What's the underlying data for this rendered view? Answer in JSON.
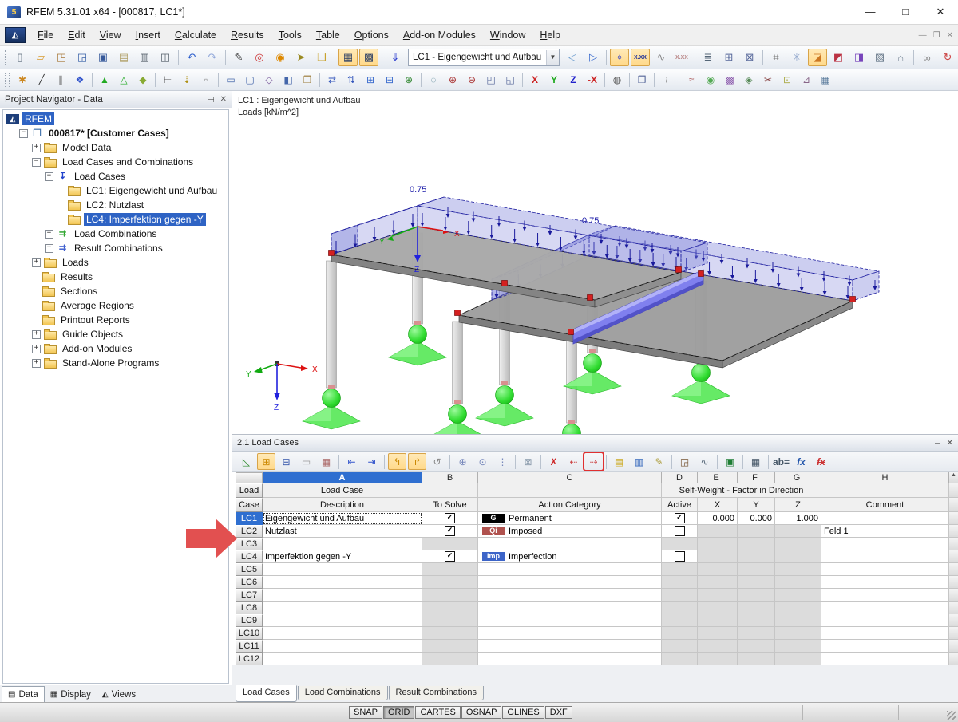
{
  "window": {
    "title": "RFEM 5.31.01 x64 - [000817, LC1*]",
    "controls": {
      "minimize": "—",
      "maximize": "□",
      "close": "✕"
    }
  },
  "menubar": {
    "items": [
      "File",
      "Edit",
      "View",
      "Insert",
      "Calculate",
      "Results",
      "Tools",
      "Table",
      "Options",
      "Add-on Modules",
      "Window",
      "Help"
    ]
  },
  "toolbar1": {
    "combo_value": "LC1 - Eigengewicht und Aufbau",
    "icons_a": [
      {
        "n": "new",
        "g": "▯",
        "c": "#5a6a7a"
      },
      {
        "n": "open",
        "g": "▱",
        "c": "#d89a2e"
      },
      {
        "n": "open-project",
        "g": "◳",
        "c": "#a87838"
      },
      {
        "n": "save-project-as",
        "g": "◲",
        "c": "#3a62a8"
      },
      {
        "n": "save",
        "g": "▣",
        "c": "#35589a"
      },
      {
        "n": "paste",
        "g": "▤",
        "c": "#b0a068"
      },
      {
        "n": "print",
        "g": "▥",
        "c": "#55606a"
      },
      {
        "n": "print-preview",
        "g": "◫",
        "c": "#55606a"
      },
      {
        "n": "undo",
        "g": "↶",
        "c": "#2a5ccc",
        "s": 1
      },
      {
        "n": "redo",
        "g": "↷",
        "c": "#93a9da"
      },
      {
        "n": "edit-polyline",
        "g": "✎",
        "c": "#3a3a3a",
        "s": 1
      },
      {
        "n": "zoom-window",
        "g": "◎",
        "c": "#cc3333"
      },
      {
        "n": "zoom-center",
        "g": "◉",
        "c": "#dd8800"
      },
      {
        "n": "pick-objects",
        "g": "➤",
        "c": "#9a8a22"
      },
      {
        "n": "new-window",
        "g": "❏",
        "c": "#c9a32f"
      },
      {
        "n": "show-tables",
        "g": "▦",
        "c": "#334466",
        "p": 1,
        "s": 1
      },
      {
        "n": "show-navigator",
        "g": "▩",
        "c": "#334466",
        "p": 1
      },
      {
        "n": "load-case-selector",
        "g": "⇓",
        "c": "#2233cc",
        "s": 1
      }
    ],
    "icons_b": [
      {
        "n": "previous-load-case",
        "g": "◁",
        "c": "#6699cc"
      },
      {
        "n": "next-load-case",
        "g": "▷",
        "c": "#3366cc"
      },
      {
        "n": "show-loads",
        "g": "⌖",
        "c": "#2233cc",
        "p": 1,
        "s": 1
      },
      {
        "n": "show-load-values",
        "g": "X.XX",
        "c": "#223399",
        "p": 1,
        "txt": 1
      },
      {
        "n": "show-results",
        "g": "∿",
        "c": "#8a8a8a"
      },
      {
        "n": "show-result-values",
        "g": "X.XX",
        "c": "#bb8888",
        "txt": 1
      },
      {
        "n": "printout-report",
        "g": "≣",
        "c": "#556677",
        "s": 1
      },
      {
        "n": "report-template",
        "g": "⊞",
        "c": "#556699"
      },
      {
        "n": "table-manager",
        "g": "⊠",
        "c": "#556699"
      },
      {
        "n": "generate-mesh",
        "g": "⌗",
        "c": "#777777",
        "s": 1
      },
      {
        "n": "mesh-settings",
        "g": "✳",
        "c": "#88a0c8"
      },
      {
        "n": "work-plane-xy",
        "g": "◪",
        "c": "#cc7722",
        "p": 1
      },
      {
        "n": "work-plane-yz",
        "g": "◩",
        "c": "#bb3344"
      },
      {
        "n": "work-plane-xz",
        "g": "◨",
        "c": "#7744bb"
      },
      {
        "n": "grid-settings",
        "g": "▧",
        "c": "#667788"
      },
      {
        "n": "snap-settings",
        "g": "⌂",
        "c": "#667788"
      },
      {
        "n": "chain-selection",
        "g": "∞",
        "c": "#888888",
        "s": 1
      },
      {
        "n": "rotate-view",
        "g": "↻",
        "c": "#cc4444"
      },
      {
        "n": "mirror",
        "g": "◭",
        "c": "#884444"
      },
      {
        "n": "delete-objects",
        "g": "✕",
        "c": "#cc2222"
      },
      {
        "n": "info",
        "g": "ⓘ",
        "c": "#2255bb"
      },
      {
        "n": "comments",
        "g": "≡",
        "c": "#778899"
      },
      {
        "n": "download-center",
        "g": "▼",
        "c": "#cc2222",
        "s": 1
      }
    ]
  },
  "toolbar2": {
    "icons": [
      {
        "n": "new-node",
        "g": "✱",
        "c": "#cc8822"
      },
      {
        "n": "new-line",
        "g": "╱",
        "c": "#333333"
      },
      {
        "n": "new-parallel-line",
        "g": "∥",
        "c": "#555555"
      },
      {
        "n": "new-member",
        "g": "❖",
        "c": "#3355cc"
      },
      {
        "n": "new-nodal-support",
        "g": "▲",
        "c": "#22aa22",
        "s": 1
      },
      {
        "n": "new-line-support",
        "g": "△",
        "c": "#22aa22"
      },
      {
        "n": "new-surface",
        "g": "◆",
        "c": "#88aa33"
      },
      {
        "n": "new-dimension",
        "g": "⊢",
        "c": "#555555",
        "s": 1
      },
      {
        "n": "new-comment",
        "g": "⇣",
        "c": "#aa8800"
      },
      {
        "n": "selection-box",
        "g": "▫",
        "c": "#777777"
      },
      {
        "n": "new-rectangle-surface",
        "g": "▭",
        "c": "#4466aa",
        "s": 1
      },
      {
        "n": "new-opening",
        "g": "▢",
        "c": "#4466aa"
      },
      {
        "n": "new-rotated-surface",
        "g": "◇",
        "c": "#775599"
      },
      {
        "n": "new-solid",
        "g": "◧",
        "c": "#4466aa"
      },
      {
        "n": "copy-object",
        "g": "❐",
        "c": "#997733"
      },
      {
        "n": "move-copy",
        "g": "⇄",
        "c": "#3355bb",
        "s": 1
      },
      {
        "n": "move-vertical",
        "g": "⇅",
        "c": "#3355bb"
      },
      {
        "n": "numbering",
        "g": "⊞",
        "c": "#3366cc"
      },
      {
        "n": "renumber",
        "g": "⊟",
        "c": "#3366cc"
      },
      {
        "n": "regenerate-model",
        "g": "⊕",
        "c": "#338833"
      },
      {
        "n": "select-special",
        "g": "◌",
        "c": "#447788",
        "s": 1
      },
      {
        "n": "zoom-in",
        "g": "⊕",
        "c": "#aa3333"
      },
      {
        "n": "zoom-out",
        "g": "⊖",
        "c": "#aa3333"
      },
      {
        "n": "isometric-view",
        "g": "◰",
        "c": "#556699"
      },
      {
        "n": "previous-view",
        "g": "◱",
        "c": "#556699"
      },
      {
        "n": "view-in-x",
        "g": "X",
        "c": "#cc2222",
        "txt": 1,
        "s": 1
      },
      {
        "n": "view-in-y",
        "g": "Y",
        "c": "#22aa22",
        "txt": 1
      },
      {
        "n": "view-in-z",
        "g": "Z",
        "c": "#2222cc",
        "txt": 1
      },
      {
        "n": "view-in-minus-x",
        "g": "-X",
        "c": "#cc2222",
        "txt": 1
      },
      {
        "n": "visibilities",
        "g": "◍",
        "c": "#555555",
        "s": 1
      },
      {
        "n": "display-properties",
        "g": "❒",
        "c": "#556699",
        "s": 1
      },
      {
        "n": "guide-lines",
        "g": "≀",
        "c": "#888888",
        "s": 1
      },
      {
        "n": "results-deformation",
        "g": "≈",
        "c": "#aa5555",
        "s": 1
      },
      {
        "n": "results-surfaces",
        "g": "◉",
        "c": "#55aa55"
      },
      {
        "n": "results-solids",
        "g": "▩",
        "c": "#8855aa"
      },
      {
        "n": "results-values",
        "g": "◈",
        "c": "#558855"
      },
      {
        "n": "section",
        "g": "✂",
        "c": "#884444"
      },
      {
        "n": "panel-toggle",
        "g": "⊡",
        "c": "#aaaa44"
      },
      {
        "n": "smooth-results",
        "g": "⊿",
        "c": "#886688"
      },
      {
        "n": "result-tables",
        "g": "▦",
        "c": "#557799"
      }
    ]
  },
  "navigator": {
    "title": "Project Navigator - Data",
    "tree": [
      {
        "label": "RFEM",
        "level": 0,
        "icon": "rfem",
        "sel": 1
      },
      {
        "label": "000817* [Customer Cases]",
        "level": 1,
        "icon": "proj",
        "exp": "-",
        "bold": 1
      },
      {
        "label": "Model Data",
        "level": 2,
        "icon": "folder",
        "exp": "+"
      },
      {
        "label": "Load Cases and Combinations",
        "level": 2,
        "icon": "folder",
        "exp": "-"
      },
      {
        "label": "Load Cases",
        "level": 3,
        "icon": "lc",
        "exp": "-"
      },
      {
        "label": "LC1: Eigengewicht und Aufbau",
        "level": 4,
        "icon": "folder"
      },
      {
        "label": "LC2: Nutzlast",
        "level": 4,
        "icon": "folder"
      },
      {
        "label": "LC4: Imperfektion gegen -Y",
        "level": 4,
        "icon": "folder",
        "sel": 1
      },
      {
        "label": "Load Combinations",
        "level": 3,
        "icon": "comb-g",
        "exp": "+"
      },
      {
        "label": "Result Combinations",
        "level": 3,
        "icon": "comb-b",
        "exp": "+"
      },
      {
        "label": "Loads",
        "level": 2,
        "icon": "folder",
        "exp": "+"
      },
      {
        "label": "Results",
        "level": 2,
        "icon": "folder"
      },
      {
        "label": "Sections",
        "level": 2,
        "icon": "folder"
      },
      {
        "label": "Average Regions",
        "level": 2,
        "icon": "folder"
      },
      {
        "label": "Printout Reports",
        "level": 2,
        "icon": "folder"
      },
      {
        "label": "Guide Objects",
        "level": 2,
        "icon": "folder",
        "exp": "+"
      },
      {
        "label": "Add-on Modules",
        "level": 2,
        "icon": "folder",
        "exp": "+"
      },
      {
        "label": "Stand-Alone Programs",
        "level": 2,
        "icon": "folder",
        "exp": "+"
      }
    ],
    "tabs": [
      {
        "label": "Data",
        "icon": "▤",
        "active": 1
      },
      {
        "label": "Display",
        "icon": "▦"
      },
      {
        "label": "Views",
        "icon": "◭"
      }
    ]
  },
  "viewport": {
    "caption1": "LC1 : Eigengewicht und Aufbau",
    "caption2": "Loads [kN/m^2]",
    "load_label_left": "0.75",
    "load_label_right": "0.75",
    "axis": {
      "x": "X",
      "y": "Y",
      "z": "Z"
    }
  },
  "load_cases_panel": {
    "title": "2.1 Load Cases",
    "toolbar_icons": [
      {
        "n": "table-settings",
        "g": "◺",
        "c": "#2e8b2e"
      },
      {
        "n": "view-filter",
        "g": "⊞",
        "c": "#cc8800",
        "p": 1
      },
      {
        "n": "sort-table",
        "g": "⊟",
        "c": "#3355aa"
      },
      {
        "n": "sync-selection",
        "g": "▭",
        "c": "#999999"
      },
      {
        "n": "table-colors",
        "g": "▦",
        "c": "#aa6666"
      },
      {
        "n": "go-first-table",
        "g": "⇤",
        "c": "#3355cc",
        "s": 1
      },
      {
        "n": "go-last-table",
        "g": "⇥",
        "c": "#3355cc"
      },
      {
        "n": "undo-table",
        "g": "↰",
        "c": "#cc8800",
        "p": 1,
        "s": 1
      },
      {
        "n": "redo-table",
        "g": "↱",
        "c": "#cc8800",
        "p": 1
      },
      {
        "n": "refresh-table",
        "g": "↺",
        "c": "#888888"
      },
      {
        "n": "move-row-up",
        "g": "⊕",
        "c": "#7788bb",
        "s": 1
      },
      {
        "n": "move-row-down",
        "g": "⊙",
        "c": "#7788bb"
      },
      {
        "n": "row-options",
        "g": "⋮",
        "c": "#7788bb"
      },
      {
        "n": "clear-table",
        "g": "⊠",
        "c": "#8899aa",
        "s": 1
      },
      {
        "n": "delete-rows",
        "g": "✗",
        "c": "#cc2222",
        "s": 1
      },
      {
        "n": "delete-empty-rows",
        "g": "⇠",
        "c": "#cc4444"
      },
      {
        "n": "insert-row",
        "g": "⇢",
        "c": "#cc4444",
        "box": 1
      },
      {
        "n": "fill-down",
        "g": "▤",
        "c": "#ccaa22",
        "s": 1
      },
      {
        "n": "select-all-rows",
        "g": "▥",
        "c": "#3366bb"
      },
      {
        "n": "edit-cell",
        "g": "✎",
        "c": "#aa9933"
      },
      {
        "n": "import-table",
        "g": "◲",
        "c": "#775533",
        "s": 1
      },
      {
        "n": "export-report",
        "g": "∿",
        "c": "#556677"
      },
      {
        "n": "export-excel",
        "g": "▣",
        "c": "#1e7e34",
        "s": 1
      },
      {
        "n": "calculator",
        "g": "▦",
        "c": "#445566",
        "s": 1
      },
      {
        "n": "abbreviations",
        "g": "ab=",
        "c": "#445566",
        "txt": 1,
        "s": 1
      },
      {
        "n": "formula",
        "g": "fx",
        "c": "#2255aa",
        "txt": 1,
        "it": 1
      },
      {
        "n": "remove-formulas",
        "g": "fx",
        "c": "#cc3333",
        "txt": 1,
        "it": 1,
        "strike": 1
      }
    ],
    "col_letters": [
      "A",
      "B",
      "C",
      "D",
      "E",
      "F",
      "G",
      "H"
    ],
    "headers": {
      "row_header_line1": "Load",
      "row_header_line2": "Case",
      "load_case": "Load Case",
      "description": "Description",
      "to_solve": "To Solve",
      "action_category": "Action Category",
      "self_weight_group": "Self-Weight  -  Factor in Direction",
      "active": "Active",
      "x": "X",
      "y": "Y",
      "z": "Z",
      "comment": "Comment"
    },
    "rows": [
      {
        "id": "LC1",
        "selected": 1,
        "description": "Eigengewicht und Aufbau",
        "to_solve": true,
        "badge": "G",
        "badge_color": "#000000",
        "category": "Permanent",
        "active": true,
        "x": "0.000",
        "y": "0.000",
        "z": "1.000",
        "comment": ""
      },
      {
        "id": "LC2",
        "description": "Nutzlast",
        "to_solve": true,
        "badge": "Qi",
        "badge_color": "#b0524e",
        "category": "Imposed",
        "active": false,
        "comment": "Feld 1"
      },
      {
        "id": "LC3"
      },
      {
        "id": "LC4",
        "description": "Imperfektion gegen -Y",
        "to_solve": true,
        "badge": "Imp",
        "badge_color": "#3c64c8",
        "category": "Imperfection",
        "active": false
      },
      {
        "id": "LC5"
      },
      {
        "id": "LC6"
      },
      {
        "id": "LC7"
      },
      {
        "id": "LC8"
      },
      {
        "id": "LC9"
      },
      {
        "id": "LC10"
      },
      {
        "id": "LC11"
      },
      {
        "id": "LC12"
      }
    ],
    "tabs": [
      {
        "label": "Load Cases",
        "active": 1
      },
      {
        "label": "Load Combinations"
      },
      {
        "label": "Result Combinations"
      }
    ]
  },
  "statusbar": {
    "buttons": [
      {
        "label": "SNAP"
      },
      {
        "label": "GRID",
        "pressed": 1
      },
      {
        "label": "CARTES"
      },
      {
        "label": "OSNAP"
      },
      {
        "label": "GLINES"
      },
      {
        "label": "DXF"
      }
    ]
  },
  "colors": {
    "selection": "#2e63c4",
    "annotation_red": "#e25050",
    "load_fill": "#7a7fd7",
    "slab_gray": "#a0a0a0",
    "support_green": "#2fd42f",
    "beam_blue": "#8080ee",
    "marker_red": "#d42020"
  }
}
